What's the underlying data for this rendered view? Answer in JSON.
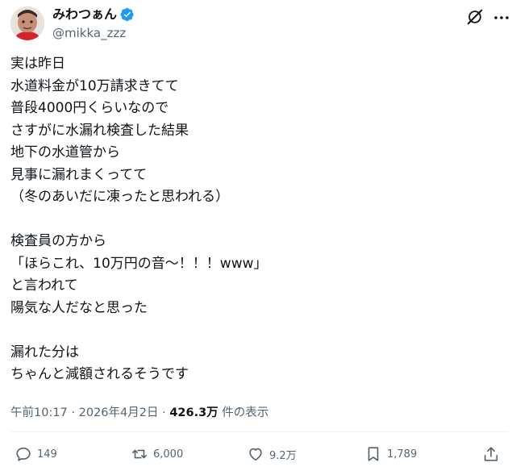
{
  "author": {
    "display_name": "みわつぁん",
    "handle": "@mikka_zzz"
  },
  "post": {
    "lines": [
      "実は昨日",
      "水道料金が10万請求きてて",
      "普段4000円くらいなので",
      "さすがに水漏れ検査した結果",
      "地下の水道管から",
      "見事に漏れまくってて",
      "（冬のあいだに凍ったと思われる）",
      "",
      "検査員の方から",
      "「ほらこれ、10万円の音〜！！！www」",
      "と言われて",
      "陽気な人だなと思った",
      "",
      "漏れた分は",
      "ちゃんと減額されるそうです"
    ]
  },
  "meta": {
    "time": "午前10:17",
    "sep1": " · ",
    "date": "2026年4月2日",
    "sep2": " · ",
    "views": "426.3万",
    "views_label": " 件の表示"
  },
  "actions": {
    "replies": "149",
    "retweets": "6,000",
    "likes": "9.2万",
    "bookmarks": "1,789"
  },
  "colors": {
    "text": "#0f1419",
    "secondary": "#536471",
    "verified": "#1d9bf0"
  }
}
